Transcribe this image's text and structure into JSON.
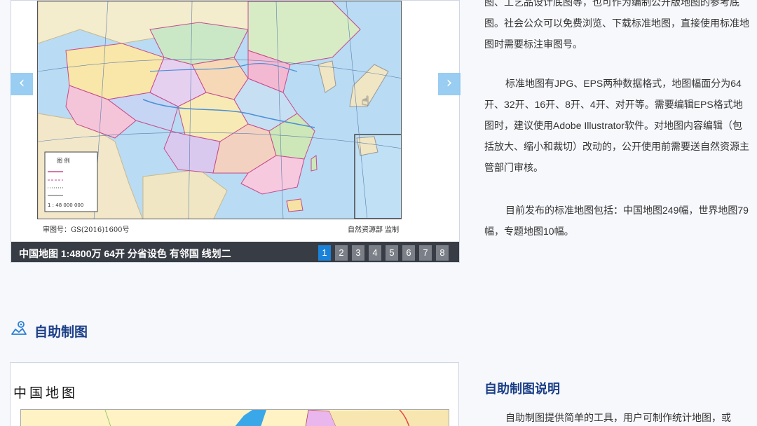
{
  "slider": {
    "caption": "中国地图 1:4800万 64开 分省设色 有邻国 线划二",
    "pages": [
      "1",
      "2",
      "3",
      "4",
      "5",
      "6",
      "7",
      "8"
    ],
    "active_page": "1",
    "prev_glyph": "‹",
    "next_glyph": "›",
    "map_footer_left": "审图号：GS(2016)1600号",
    "map_footer_right": "自然资源部 监制",
    "legend_title": "图 例",
    "legend_scale": "1 : 48 000 000",
    "colors": {
      "active_page": "#1a82d8",
      "caption_bg": "#383d45",
      "arrow_bg": "#8ec8f0"
    }
  },
  "intro": {
    "para1": "图、工艺品设计底图等，也可作为编制公开版地图的参考底图。社会公众可以免费浏览、下载标准地图，直接使用标准地图时需要标注审图号。",
    "para2": "标准地图有JPG、EPS两种数据格式，地图幅面分为64开、32开、16开、8开、4开、对开等。需要编辑EPS格式地图时，建议使用Adobe Illustrator软件。对地图内容编辑（包括放大、缩小和裁切）改动的，公开使用前需要送自然资源主管部门审核。",
    "para3": "目前发布的标准地图包括：中国地图249幅，世界地图79幅，专题地图10幅。"
  },
  "section": {
    "icon": "map-pin-icon",
    "title": "自助制图",
    "title_color": "#1b3f87"
  },
  "custom": {
    "map_title": "中国地图",
    "heading": "自助制图说明",
    "desc": "自助制图提供简单的工具，用户可制作统计地图，或"
  }
}
